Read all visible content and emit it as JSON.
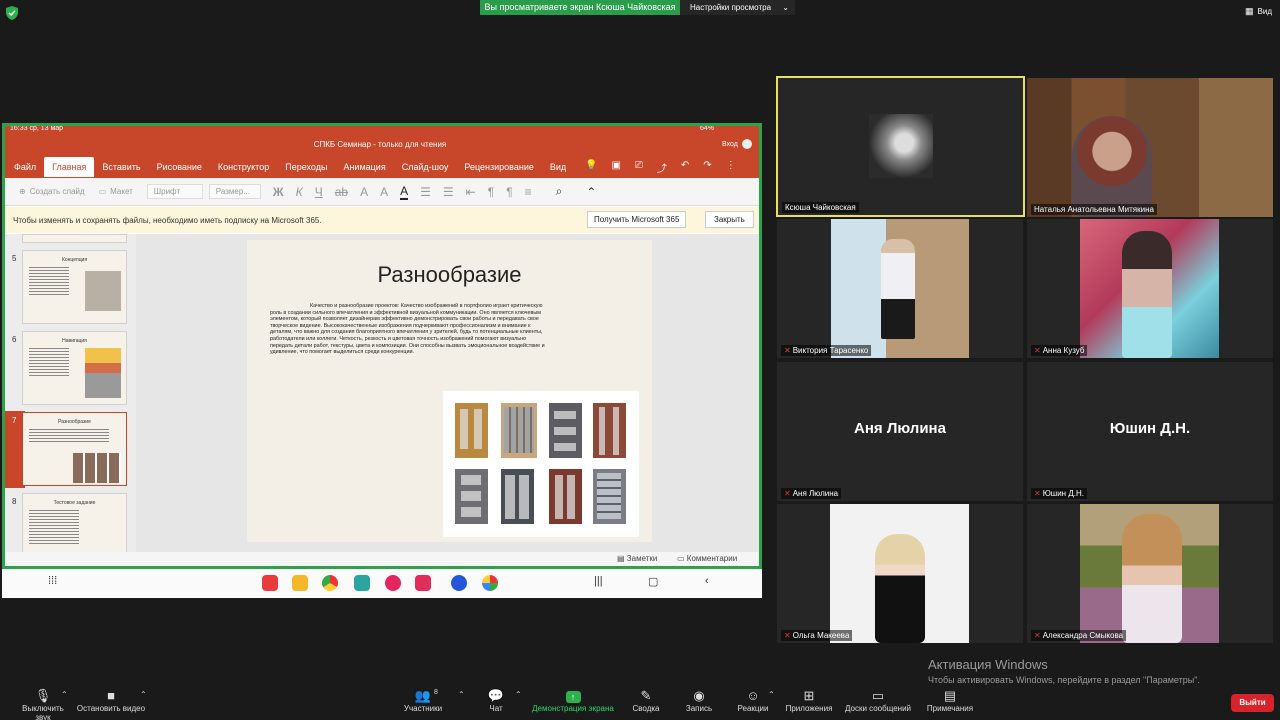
{
  "top": {
    "share_banner": "Вы просматриваете экран Ксюша Чайковская",
    "view_settings": "Настройки просмотра",
    "view_button": "Вид"
  },
  "shared_screen": {
    "status_left": "16:33  ср, 13 мар",
    "status_right": "64%",
    "doc_title": "СПКБ Семинар - только для чтения",
    "login": "Вход",
    "tabs": [
      "Файл",
      "Главная",
      "Вставить",
      "Рисование",
      "Конструктор",
      "Переходы",
      "Анимация",
      "Слайд-шоу",
      "Рецензирование",
      "Вид"
    ],
    "active_tab": "Главная",
    "toolbar": {
      "new_slide": "Создать слайд",
      "layout": "Макет",
      "font": "Шрифт",
      "size": "Размер..."
    },
    "notice": {
      "text": "Чтобы изменять и сохранять файлы, необходимо иметь подписку на Microsoft 365.",
      "get_button": "Получить Microsoft 365",
      "close_button": "Закрыть"
    },
    "thumbnails": [
      {
        "num": "5",
        "title": "Концепция"
      },
      {
        "num": "6",
        "title": "Навигация"
      },
      {
        "num": "7",
        "title": "Разнообразие"
      },
      {
        "num": "8",
        "title": "Тестовое задание"
      }
    ],
    "slide": {
      "title": "Разнообразие",
      "body": "Качество и разнообразие проектов: Качество изображений в портфолио играет критическую роль в создании сильного впечатления и эффективной визуальной коммуникации. Оно является ключевым элементом, который позволяет дизайнерам эффективно демонстрировать свои работы и передавать свое творческое видение. Высококачественные изображения подчеркивают профессионализм и внимание к деталям, что важно для создания благоприятного впечатления у зрителей, будь то потенциальные клиенты, работодатели или коллеги. Четкость, резкость и цветовая точность изображений помогают визуально передать детали работ, текстуры, цвета и композиции. Они способны вызвать эмоциональное воздействие и удивление, что помогает выделиться среди конкуренции."
    },
    "notes": "Заметки",
    "comments": "Комментарии"
  },
  "participants": [
    {
      "name": "Ксюша Чайковская",
      "muted": false,
      "active": true
    },
    {
      "name": "Наталья Анатольевна Митякина",
      "muted": false,
      "active": false
    },
    {
      "name": "Виктория Тарасенко",
      "muted": true,
      "active": false
    },
    {
      "name": "Анна Кузуб",
      "muted": true,
      "active": false
    },
    {
      "name": "Аня Люлина",
      "muted": true,
      "active": false,
      "big": "Аня Люлина"
    },
    {
      "name": "Юшин Д.Н.",
      "muted": true,
      "active": false,
      "big": "Юшин Д.Н."
    },
    {
      "name": "Ольга Макеева",
      "muted": true,
      "active": false
    },
    {
      "name": "Александра Смыкова",
      "muted": true,
      "active": false
    }
  ],
  "watermark": {
    "line1": "Активация Windows",
    "line2": "Чтобы активировать Windows, перейдите в раздел \"Параметры\"."
  },
  "controls": {
    "mute": "Выключить звук",
    "video": "Остановить видео",
    "participants": "Участники",
    "participants_count": "8",
    "chat": "Чат",
    "share": "Демонстрация экрана",
    "board": "Сводка",
    "record": "Запись",
    "reactions": "Реакции",
    "apps": "Приложения",
    "whiteboard": "Доски сообщений",
    "notes": "Примечания",
    "leave": "Выйти"
  },
  "colors": {
    "zoom_green": "#2a9d4b",
    "ppt_orange": "#c8472a",
    "active_speaker": "#e6df6c",
    "leave_red": "#d9232a"
  }
}
